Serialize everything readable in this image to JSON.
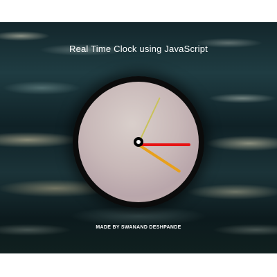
{
  "header": {
    "title": "Real Time Clock using JavaScript"
  },
  "clock": {
    "hour_hand_color": "#e7a01b",
    "minute_hand_color": "#e61414",
    "second_hand_color": "#c9c25a"
  },
  "footer": {
    "credit": "MADE BY SWANAND DESHPANDE"
  }
}
